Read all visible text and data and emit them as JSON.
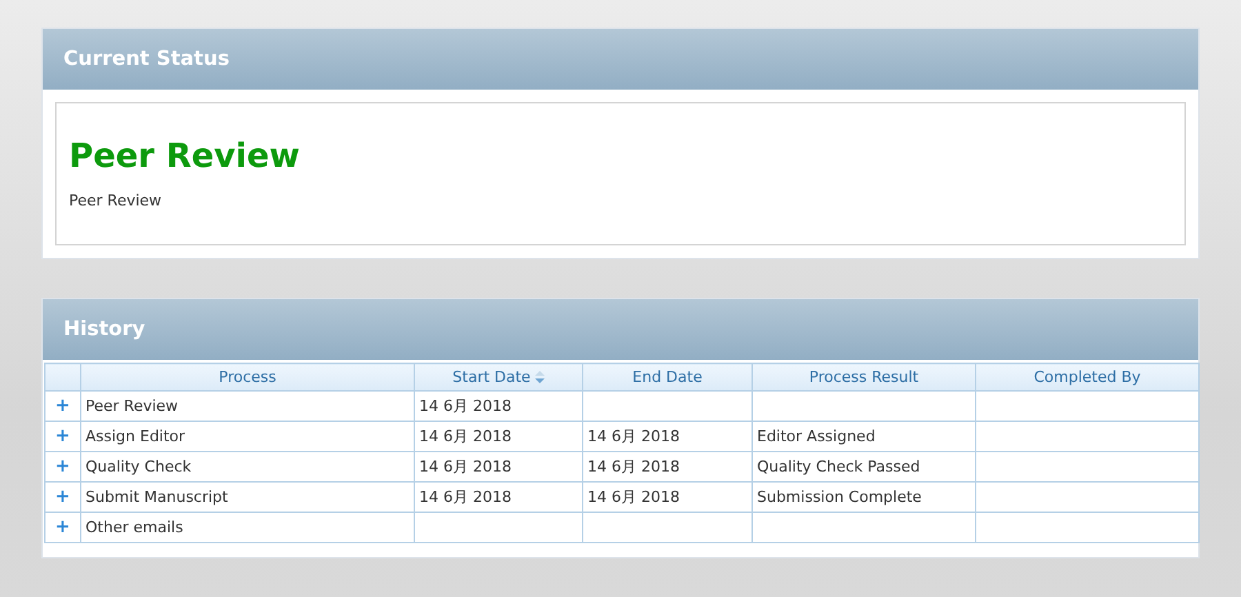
{
  "current_status": {
    "title": "Current Status",
    "stage": "Peer Review",
    "description": "Peer Review"
  },
  "history": {
    "title": "History",
    "columns": [
      {
        "label": "Process",
        "sorted": false
      },
      {
        "label": "Start Date",
        "sorted": true
      },
      {
        "label": "End Date",
        "sorted": false
      },
      {
        "label": "Process Result",
        "sorted": false
      },
      {
        "label": "Completed By",
        "sorted": false
      }
    ],
    "rows": [
      {
        "expand": "+",
        "process": "Peer Review",
        "start_date": "14 6月 2018"
      },
      {
        "expand": "+",
        "process": "Assign Editor",
        "start_date": "14 6月 2018",
        "end_date": "14 6月 2018",
        "result": "Editor Assigned"
      },
      {
        "expand": "+",
        "process": "Quality Check",
        "start_date": "14 6月 2018",
        "end_date": "14 6月 2018",
        "result": "Quality Check Passed"
      },
      {
        "expand": "+",
        "process": "Submit Manuscript",
        "start_date": "14 6月 2018",
        "end_date": "14 6月 2018",
        "result": "Submission Complete"
      },
      {
        "expand": "+",
        "process": "Other emails"
      }
    ]
  }
}
